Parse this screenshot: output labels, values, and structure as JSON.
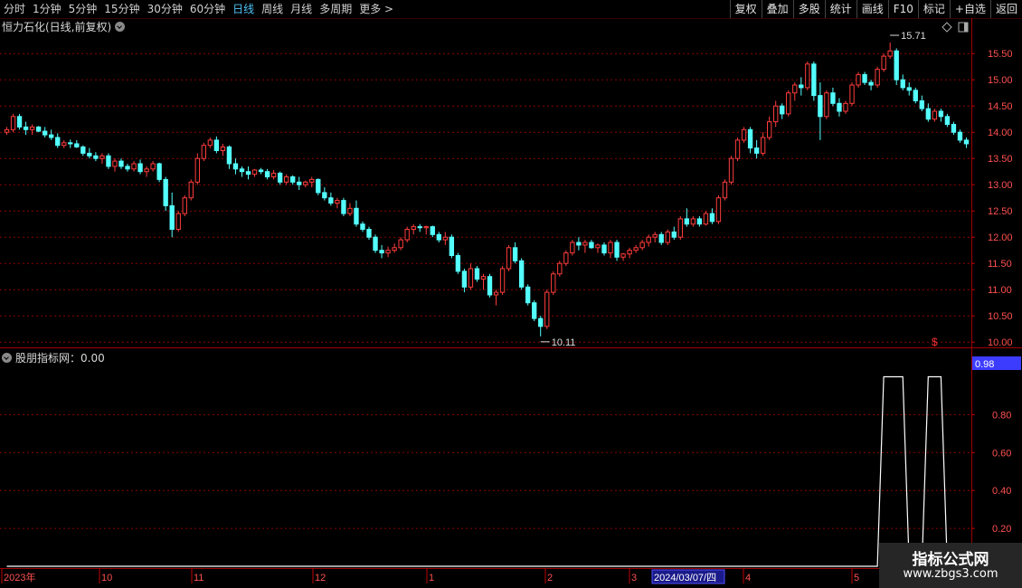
{
  "toolbar": {
    "periods": [
      "分时",
      "1分钟",
      "5分钟",
      "15分钟",
      "30分钟",
      "60分钟",
      "日线",
      "周线",
      "月线",
      "多周期",
      "更多 >"
    ],
    "active_period": "日线",
    "buttons": [
      "复权",
      "叠加",
      "多股",
      "统计",
      "画线",
      "F10",
      "标记",
      "+自选",
      "返回"
    ]
  },
  "chart": {
    "title": "恒力石化(日线,前复权)",
    "indicator_title": "股朋指标网：0.00",
    "max_label": "15.71",
    "min_label": "10.11",
    "price_axis": [
      "15.50",
      "15.00",
      "14.50",
      "14.00",
      "13.50",
      "13.00",
      "12.50",
      "12.00",
      "11.50",
      "11.00",
      "10.50",
      "10.00"
    ],
    "indicator_axis": [
      "0.80",
      "0.60",
      "0.40",
      "0.20"
    ],
    "indicator_current": "0.98",
    "date_labels": [
      "2023年",
      "10",
      "11",
      "12",
      "1",
      "2",
      "3",
      "4",
      "5"
    ],
    "date_tooltip": "2024/03/07/四",
    "dollar_mark": "$",
    "colors": {
      "up": "#ff3c3c",
      "down": "#54ffff",
      "grid": "#8b0000",
      "accent": "#3c3cff"
    }
  },
  "chart_data": {
    "type": "candlestick",
    "ylim": [
      9.9,
      15.9
    ],
    "ohlc": [
      [
        14.0,
        14.1,
        13.95,
        14.05
      ],
      [
        14.05,
        14.35,
        14.0,
        14.3
      ],
      [
        14.3,
        14.35,
        14.05,
        14.1
      ],
      [
        14.1,
        14.2,
        13.95,
        14.05
      ],
      [
        14.05,
        14.15,
        13.95,
        14.1
      ],
      [
        14.1,
        14.12,
        14.0,
        14.02
      ],
      [
        14.02,
        14.1,
        13.9,
        13.95
      ],
      [
        13.95,
        14.05,
        13.85,
        13.9
      ],
      [
        13.9,
        13.98,
        13.7,
        13.75
      ],
      [
        13.75,
        13.85,
        13.7,
        13.8
      ],
      [
        13.8,
        13.86,
        13.7,
        13.78
      ],
      [
        13.78,
        13.85,
        13.7,
        13.72
      ],
      [
        13.72,
        13.75,
        13.55,
        13.6
      ],
      [
        13.6,
        13.7,
        13.5,
        13.55
      ],
      [
        13.55,
        13.62,
        13.45,
        13.5
      ],
      [
        13.5,
        13.6,
        13.4,
        13.55
      ],
      [
        13.55,
        13.6,
        13.3,
        13.35
      ],
      [
        13.35,
        13.5,
        13.25,
        13.45
      ],
      [
        13.45,
        13.5,
        13.3,
        13.35
      ],
      [
        13.35,
        13.4,
        13.25,
        13.3
      ],
      [
        13.3,
        13.45,
        13.25,
        13.4
      ],
      [
        13.4,
        13.48,
        13.2,
        13.25
      ],
      [
        13.25,
        13.35,
        13.15,
        13.3
      ],
      [
        13.3,
        13.45,
        13.25,
        13.4
      ],
      [
        13.4,
        13.42,
        13.05,
        13.1
      ],
      [
        13.1,
        13.15,
        12.5,
        12.6
      ],
      [
        12.6,
        12.85,
        12.0,
        12.15
      ],
      [
        12.15,
        12.5,
        12.1,
        12.45
      ],
      [
        12.45,
        12.8,
        12.4,
        12.75
      ],
      [
        12.75,
        13.1,
        12.7,
        13.05
      ],
      [
        13.05,
        13.6,
        13.0,
        13.5
      ],
      [
        13.5,
        13.8,
        13.45,
        13.75
      ],
      [
        13.75,
        13.9,
        13.7,
        13.85
      ],
      [
        13.85,
        13.92,
        13.6,
        13.65
      ],
      [
        13.65,
        13.78,
        13.55,
        13.72
      ],
      [
        13.72,
        13.75,
        13.3,
        13.4
      ],
      [
        13.4,
        13.5,
        13.2,
        13.3
      ],
      [
        13.3,
        13.35,
        13.15,
        13.25
      ],
      [
        13.25,
        13.35,
        13.1,
        13.2
      ],
      [
        13.2,
        13.3,
        13.15,
        13.28
      ],
      [
        13.28,
        13.32,
        13.2,
        13.25
      ],
      [
        13.25,
        13.3,
        13.1,
        13.15
      ],
      [
        13.15,
        13.28,
        13.1,
        13.22
      ],
      [
        13.22,
        13.25,
        13.0,
        13.05
      ],
      [
        13.05,
        13.2,
        13.0,
        13.15
      ],
      [
        13.15,
        13.18,
        13.0,
        13.05
      ],
      [
        13.05,
        13.15,
        12.9,
        13.0
      ],
      [
        13.0,
        13.08,
        12.95,
        13.05
      ],
      [
        13.05,
        13.15,
        12.95,
        13.1
      ],
      [
        13.1,
        13.12,
        12.8,
        12.85
      ],
      [
        12.85,
        12.95,
        12.7,
        12.75
      ],
      [
        12.75,
        12.85,
        12.6,
        12.65
      ],
      [
        12.65,
        12.75,
        12.55,
        12.7
      ],
      [
        12.7,
        12.75,
        12.4,
        12.45
      ],
      [
        12.45,
        12.65,
        12.4,
        12.55
      ],
      [
        12.55,
        12.7,
        12.2,
        12.25
      ],
      [
        12.25,
        12.3,
        12.1,
        12.15
      ],
      [
        12.15,
        12.2,
        11.95,
        12.0
      ],
      [
        12.0,
        12.05,
        11.7,
        11.75
      ],
      [
        11.75,
        11.85,
        11.6,
        11.7
      ],
      [
        11.7,
        11.82,
        11.62,
        11.75
      ],
      [
        11.75,
        11.88,
        11.7,
        11.8
      ],
      [
        11.8,
        12.0,
        11.75,
        11.95
      ],
      [
        11.95,
        12.2,
        11.9,
        12.15
      ],
      [
        12.15,
        12.25,
        12.05,
        12.2
      ],
      [
        12.2,
        12.25,
        12.1,
        12.18
      ],
      [
        12.18,
        12.22,
        12.05,
        12.2
      ],
      [
        12.2,
        12.22,
        12.0,
        12.05
      ],
      [
        12.05,
        12.1,
        11.9,
        11.95
      ],
      [
        11.95,
        12.1,
        11.85,
        12.0
      ],
      [
        12.0,
        12.05,
        11.6,
        11.65
      ],
      [
        11.65,
        11.7,
        11.3,
        11.35
      ],
      [
        11.35,
        11.4,
        10.95,
        11.05
      ],
      [
        11.05,
        11.5,
        11.0,
        11.4
      ],
      [
        11.4,
        11.45,
        11.15,
        11.2
      ],
      [
        11.2,
        11.3,
        11.0,
        11.25
      ],
      [
        11.25,
        11.3,
        10.85,
        10.9
      ],
      [
        10.9,
        11.0,
        10.7,
        10.95
      ],
      [
        10.95,
        11.45,
        10.9,
        11.4
      ],
      [
        11.4,
        11.85,
        11.35,
        11.8
      ],
      [
        11.8,
        11.9,
        11.5,
        11.55
      ],
      [
        11.55,
        11.6,
        11.0,
        11.05
      ],
      [
        11.05,
        11.1,
        10.7,
        10.75
      ],
      [
        10.75,
        10.8,
        10.4,
        10.45
      ],
      [
        10.45,
        10.5,
        10.11,
        10.3
      ],
      [
        10.3,
        11.0,
        10.25,
        10.95
      ],
      [
        10.95,
        11.35,
        10.9,
        11.3
      ],
      [
        11.3,
        11.55,
        11.25,
        11.5
      ],
      [
        11.5,
        11.75,
        11.45,
        11.7
      ],
      [
        11.7,
        11.95,
        11.65,
        11.9
      ],
      [
        11.9,
        12.0,
        11.75,
        11.85
      ],
      [
        11.85,
        11.95,
        11.7,
        11.9
      ],
      [
        11.9,
        11.95,
        11.78,
        11.8
      ],
      [
        11.8,
        11.88,
        11.7,
        11.85
      ],
      [
        11.85,
        11.9,
        11.65,
        11.7
      ],
      [
        11.7,
        11.95,
        11.6,
        11.9
      ],
      [
        11.9,
        11.95,
        11.55,
        11.62
      ],
      [
        11.62,
        11.7,
        11.55,
        11.68
      ],
      [
        11.68,
        11.8,
        11.6,
        11.75
      ],
      [
        11.75,
        11.85,
        11.7,
        11.8
      ],
      [
        11.8,
        11.95,
        11.75,
        11.9
      ],
      [
        11.9,
        12.05,
        11.82,
        12.0
      ],
      [
        12.0,
        12.1,
        11.9,
        12.05
      ],
      [
        12.05,
        12.1,
        11.85,
        11.9
      ],
      [
        11.9,
        12.15,
        11.85,
        12.1
      ],
      [
        12.1,
        12.2,
        11.95,
        12.0
      ],
      [
        12.0,
        12.4,
        11.95,
        12.35
      ],
      [
        12.35,
        12.55,
        12.2,
        12.25
      ],
      [
        12.25,
        12.4,
        12.2,
        12.35
      ],
      [
        12.35,
        12.4,
        12.2,
        12.25
      ],
      [
        12.25,
        12.5,
        12.22,
        12.45
      ],
      [
        12.45,
        12.55,
        12.25,
        12.3
      ],
      [
        12.3,
        12.8,
        12.25,
        12.75
      ],
      [
        12.75,
        13.1,
        12.7,
        13.05
      ],
      [
        13.05,
        13.55,
        13.0,
        13.5
      ],
      [
        13.5,
        13.9,
        13.45,
        13.85
      ],
      [
        13.85,
        14.1,
        13.8,
        14.05
      ],
      [
        14.05,
        14.1,
        13.6,
        13.7
      ],
      [
        13.7,
        13.85,
        13.5,
        13.6
      ],
      [
        13.6,
        14.0,
        13.55,
        13.9
      ],
      [
        13.9,
        14.3,
        13.85,
        14.2
      ],
      [
        14.2,
        14.6,
        14.1,
        14.5
      ],
      [
        14.5,
        14.55,
        14.25,
        14.35
      ],
      [
        14.35,
        14.8,
        14.3,
        14.75
      ],
      [
        14.75,
        14.95,
        14.6,
        14.9
      ],
      [
        14.9,
        15.05,
        14.7,
        14.85
      ],
      [
        14.85,
        15.35,
        14.8,
        15.3
      ],
      [
        15.3,
        15.35,
        14.6,
        14.7
      ],
      [
        14.7,
        14.95,
        13.85,
        14.3
      ],
      [
        14.3,
        14.8,
        14.25,
        14.75
      ],
      [
        14.75,
        14.85,
        14.5,
        14.55
      ],
      [
        14.55,
        14.65,
        14.3,
        14.4
      ],
      [
        14.4,
        14.6,
        14.35,
        14.55
      ],
      [
        14.55,
        14.95,
        14.5,
        14.9
      ],
      [
        14.9,
        15.15,
        14.85,
        15.1
      ],
      [
        15.1,
        15.15,
        14.9,
        14.95
      ],
      [
        14.95,
        15.0,
        14.8,
        14.9
      ],
      [
        14.9,
        15.25,
        14.85,
        15.2
      ],
      [
        15.2,
        15.5,
        15.15,
        15.45
      ],
      [
        15.45,
        15.71,
        15.4,
        15.55
      ],
      [
        15.55,
        15.6,
        14.9,
        15.0
      ],
      [
        15.0,
        15.1,
        14.8,
        14.85
      ],
      [
        14.85,
        14.95,
        14.7,
        14.8
      ],
      [
        14.8,
        14.85,
        14.55,
        14.6
      ],
      [
        14.6,
        14.7,
        14.4,
        14.45
      ],
      [
        14.45,
        14.55,
        14.2,
        14.25
      ],
      [
        14.25,
        14.45,
        14.2,
        14.4
      ],
      [
        14.4,
        14.45,
        14.2,
        14.3
      ],
      [
        14.3,
        14.35,
        14.1,
        14.15
      ],
      [
        14.15,
        14.2,
        13.95,
        14.0
      ],
      [
        14.0,
        14.05,
        13.8,
        13.85
      ],
      [
        13.85,
        13.9,
        13.7,
        13.78
      ]
    ],
    "indicator": {
      "name": "股朋指标网",
      "current": 0.98,
      "ylim": [
        0,
        1.05
      ],
      "spikes": [
        {
          "start_bar": 138,
          "end_bar": 141,
          "value": 1.0
        },
        {
          "start_bar": 145,
          "end_bar": 147,
          "value": 1.0
        }
      ]
    }
  },
  "watermark": {
    "line1": "指标公式网",
    "line2": "www.zbgs3.com"
  }
}
